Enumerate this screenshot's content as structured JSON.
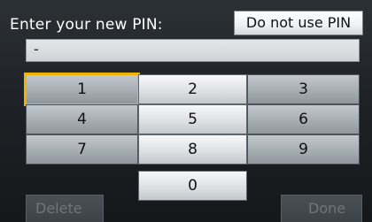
{
  "header": {
    "title": "Enter your new PIN:",
    "no_pin_label": "Do not use PIN"
  },
  "pin_field": {
    "value": "-"
  },
  "keypad": {
    "selected_key": "1",
    "keys": [
      "1",
      "2",
      "3",
      "4",
      "5",
      "6",
      "7",
      "8",
      "9",
      "0"
    ]
  },
  "actions": {
    "delete_label": "Delete",
    "done_label": "Done",
    "enabled": false
  },
  "colors": {
    "selection": "#f0b400",
    "background": "#1e2226"
  }
}
